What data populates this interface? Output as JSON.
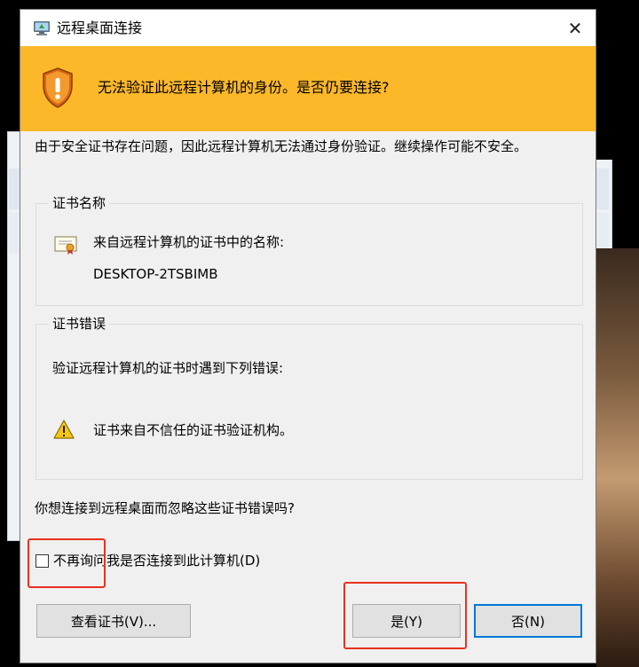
{
  "window": {
    "title": "远程桌面连接",
    "close_glyph": "✕"
  },
  "banner": {
    "color": "#fcb829",
    "message": "无法验证此远程计算机的身份。是否仍要连接?",
    "icon": "shield-warning-icon"
  },
  "description": "由于安全证书存在问题，因此远程计算机无法通过身份验证。继续操作可能不安全。",
  "certificate_name": {
    "group_title": "证书名称",
    "label": "来自远程计算机的证书中的名称:",
    "value": "DESKTOP-2TSBIMB",
    "icon": "certificate-icon"
  },
  "certificate_errors": {
    "group_title": "证书错误",
    "intro": "验证远程计算机的证书时遇到下列错误:",
    "items": [
      {
        "icon": "warning-icon",
        "text": "证书来自不信任的证书验证机构。"
      }
    ]
  },
  "question": "你想连接到远程桌面而忽略这些证书错误吗?",
  "dont_ask_checkbox": {
    "label": "不再询问我是否连接到此计算机(D)",
    "checked": false
  },
  "buttons": {
    "view_certificate": "查看证书(V)...",
    "yes": "是(Y)",
    "no": "否(N)"
  },
  "colors": {
    "annotation": "#e8311d",
    "focus": "#0078d7"
  }
}
